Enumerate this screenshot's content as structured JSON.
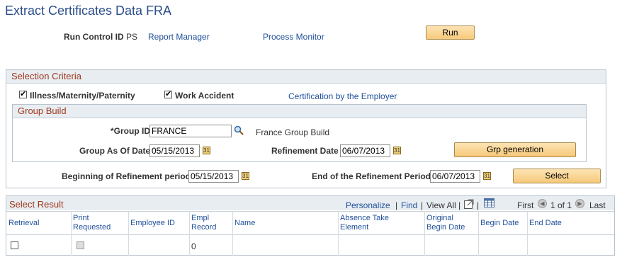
{
  "page": {
    "title": "Extract Certificates Data FRA"
  },
  "run_control": {
    "label": "Run Control ID",
    "value": "PS",
    "report_manager": "Report Manager",
    "process_monitor": "Process Monitor",
    "run_button": "Run"
  },
  "selection": {
    "header": "Selection Criteria",
    "illness_label": "Illness/Maternity/Paternity",
    "illness_checked": true,
    "work_accident_label": "Work Accident",
    "work_accident_checked": true,
    "certification_link": "Certification by the Employer"
  },
  "group_build": {
    "header": "Group Build",
    "group_id_label": "*Group ID",
    "group_id_value": "FRANCE",
    "group_desc": "France Group Build",
    "group_as_of_label": "Group As Of Date",
    "group_as_of_value": "05/15/2013",
    "refinement_label": "Refinement Date",
    "refinement_value": "06/07/2013",
    "grp_button": "Grp generation"
  },
  "refinement_period": {
    "begin_label": "Beginning of Refinement period",
    "begin_value": "05/15/2013",
    "end_label": "End of the Refinement Period",
    "end_value": "06/07/2013",
    "select_button": "Select"
  },
  "results": {
    "header": "Select Result",
    "personalize": "Personalize",
    "find": "Find",
    "view_all": "View All",
    "separator": "|",
    "first": "First",
    "range": "1 of 1",
    "last": "Last",
    "columns": [
      "Retrieval",
      "Print\nRequested",
      "Employee ID",
      "Empl\nRecord",
      "Name",
      "Absence Take\nElement",
      "Original\nBegin Date",
      "Begin Date",
      "End Date"
    ],
    "row": {
      "empl_record": "0"
    }
  },
  "icons": {
    "search": "search-icon",
    "calendar": "calendar-icon",
    "zoom": "zoom-icon",
    "grid": "grid-icon",
    "prev": "arrow-left-icon",
    "next": "arrow-right-icon"
  }
}
